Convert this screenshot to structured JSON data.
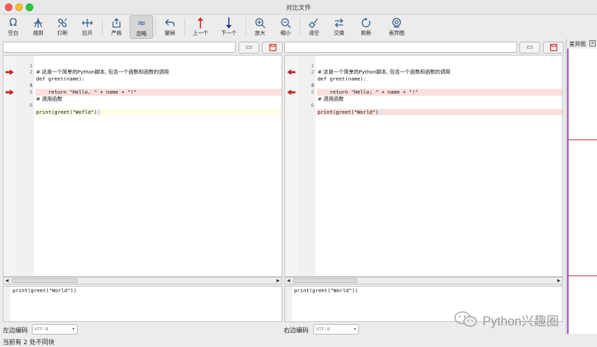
{
  "window": {
    "title": "对比文件"
  },
  "toolbar": {
    "items": [
      {
        "label": "空白",
        "icon": "omega-icon"
      },
      {
        "label": "规则",
        "icon": "rule-icon"
      },
      {
        "label": "打断",
        "icon": "break-link-icon"
      },
      {
        "label": "拉开",
        "icon": "expand-icon"
      },
      {
        "label": "严格",
        "icon": "upload-icon"
      },
      {
        "label": "忽略",
        "icon": "approx-icon",
        "active": true
      },
      {
        "label": "撤销",
        "icon": "undo-icon"
      },
      {
        "label": "上一个",
        "icon": "arrow-up-icon"
      },
      {
        "label": "下一个",
        "icon": "arrow-down-icon"
      },
      {
        "label": "放大",
        "icon": "zoom-in-icon"
      },
      {
        "label": "缩小",
        "icon": "zoom-out-icon"
      },
      {
        "label": "清空",
        "icon": "broom-icon"
      },
      {
        "label": "交换",
        "icon": "swap-icon"
      },
      {
        "label": "刷新",
        "icon": "refresh-icon"
      },
      {
        "label": "差异图",
        "icon": "diff-map-icon"
      }
    ]
  },
  "left": {
    "path_value": "",
    "lines": [
      {
        "no": "1",
        "text": "# 这是一个简单的Python脚本, 包含一个函数和函数的调用",
        "marked": false
      },
      {
        "no": "2",
        "text": "def greet(name):",
        "marked": false
      },
      {
        "no": "3",
        "text": "    return \"Hello, \" + name + \"!\"",
        "marked": true
      },
      {
        "no": "4",
        "text": "",
        "marked": false
      },
      {
        "no": "5",
        "text": "# 调用函数",
        "marked": false
      },
      {
        "no": "6",
        "text": "print(greet(\"Wofld\")",
        "marked": true
      }
    ],
    "preview_text": "print(greet(\"World\"))",
    "encoding_label": "左边编码",
    "encoding_value": "UTF-8"
  },
  "right": {
    "path_value": "",
    "lines": [
      {
        "no": "1",
        "text": "# 这是一个简单的Python脚本, 包含一个函数和函数的调用",
        "marked": false
      },
      {
        "no": "2",
        "text": "def greet(name):",
        "marked": false
      },
      {
        "no": "3",
        "text": "    return \"Hello; \" + name + \"!\"",
        "marked": true
      },
      {
        "no": "4",
        "text": "",
        "marked": false
      },
      {
        "no": "5",
        "text": "# 调用函数",
        "marked": false
      },
      {
        "no": "6",
        "text": "print(greet(\"World\")",
        "marked": true
      }
    ],
    "preview_text": "print(greet(\"World\"))",
    "encoding_label": "右边编码",
    "encoding_value": "UTF-8"
  },
  "overview": {
    "title": "差异图"
  },
  "status": {
    "text": "当前有 2 处不同块"
  },
  "watermark": {
    "text": "Python兴趣圈"
  },
  "colors": {
    "diff_bg": "#fbdede",
    "current_bg": "#fdfbe2",
    "marker_red": "#cc2222",
    "overview_border": "#9a4fb5"
  }
}
